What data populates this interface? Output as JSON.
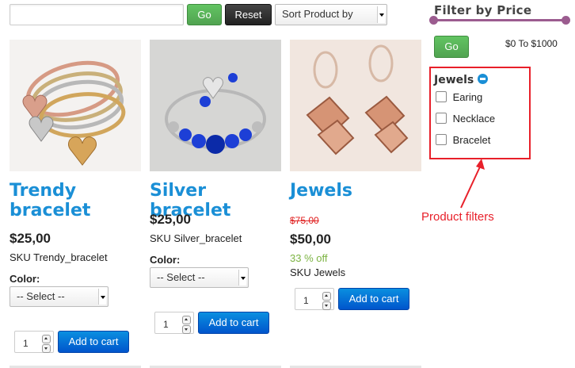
{
  "toolbar": {
    "search_value": "",
    "go_label": "Go",
    "reset_label": "Reset",
    "sort_selected": "Sort Product by"
  },
  "products": [
    {
      "title_line1": "Trendy",
      "title_line2": "bracelet",
      "price": "$25,00",
      "sku": "SKU Trendy_bracelet",
      "color_label": "Color:",
      "color_selected": "-- Select --",
      "qty": "1",
      "cart_label": "Add to cart"
    },
    {
      "title_line1": "Silver bracelet",
      "price": "$25,00",
      "sku": "SKU Silver_bracelet",
      "color_label": "Color:",
      "color_selected": "-- Select --",
      "qty": "1",
      "cart_label": "Add to cart"
    },
    {
      "title_line1": "Jewels",
      "old_price": "$75,00",
      "price": "$50,00",
      "discount": "33 % off",
      "sku": "SKU Jewels",
      "qty": "1",
      "cart_label": "Add to cart"
    }
  ],
  "filter": {
    "heading": "Filter by Price",
    "price_range_text": "$0 To $1000",
    "go_label": "Go",
    "price_min_fraction": 0.0,
    "price_max_fraction": 1.0,
    "category_heading": "Jewels",
    "options": [
      "Earing",
      "Necklace",
      "Bracelet"
    ]
  },
  "annotation": {
    "label": "Product filters",
    "color": "#e8202a"
  },
  "colors": {
    "link_blue": "#1a8fd6",
    "discount_green": "#7cb342",
    "strike_red": "#e02020",
    "slider_purple": "#9b5c8f"
  }
}
